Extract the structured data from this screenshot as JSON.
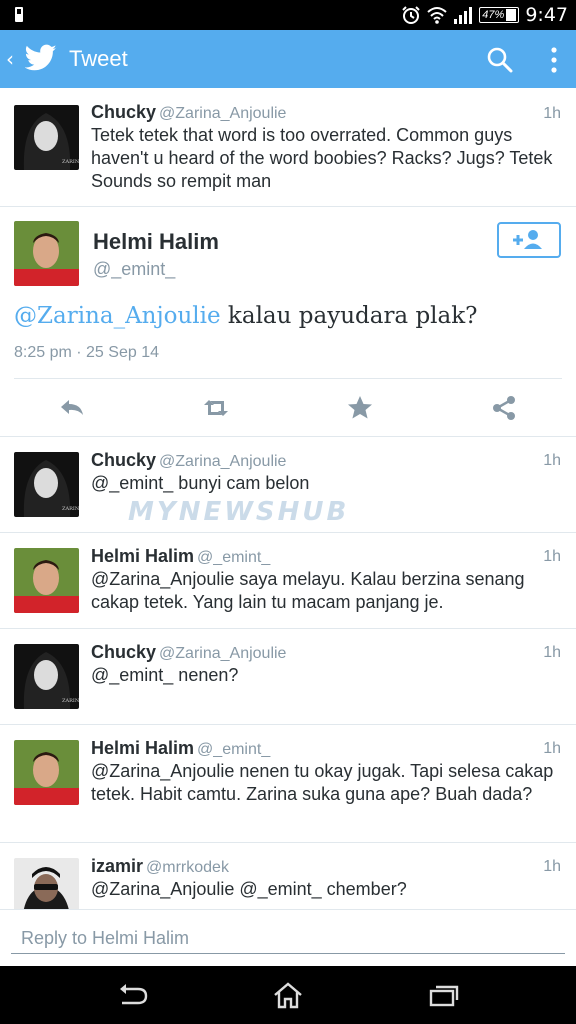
{
  "status_bar": {
    "time": "9:47",
    "battery": "47%"
  },
  "app_bar": {
    "back": "‹",
    "title": "Tweet"
  },
  "replies_above": [
    {
      "name": "Chucky",
      "handle": "@Zarina_Anjoulie",
      "time": "1h",
      "text": "Tetek tetek that word is too overrated. Common guys haven't u heard of the word boobies? Racks? Jugs? Tetek Sounds so rempit man"
    }
  ],
  "main_tweet": {
    "name": "Helmi Halim",
    "handle": "@_emint_",
    "mention": "@Zarina_Anjoulie",
    "text": " kalau payudara plak?",
    "meta": "8:25 pm · 25 Sep 14"
  },
  "replies_below": [
    {
      "name": "Chucky",
      "handle": "@Zarina_Anjoulie",
      "time": "1h",
      "text": "@_emint_ bunyi cam belon"
    },
    {
      "name": "Helmi Halim",
      "handle": "@_emint_",
      "time": "1h",
      "text": "@Zarina_Anjoulie saya melayu. Kalau berzina senang cakap tetek. Yang lain tu macam panjang je."
    },
    {
      "name": "Chucky",
      "handle": "@Zarina_Anjoulie",
      "time": "1h",
      "text": "@_emint_ nenen?"
    },
    {
      "name": "Helmi Halim",
      "handle": "@_emint_",
      "time": "1h",
      "text": "@Zarina_Anjoulie nenen tu okay jugak. Tapi selesa cakap tetek. Habit camtu. Zarina suka guna ape? Buah dada?"
    },
    {
      "name": "izamir",
      "handle": "@mrrkodek",
      "time": "1h",
      "text": "@Zarina_Anjoulie @_emint_ chember?"
    }
  ],
  "watermark": "MYNEWSHUB",
  "reply_box": {
    "placeholder": "Reply to Helmi Halim"
  },
  "icons": {
    "status": [
      "alarm-icon",
      "wifi-icon",
      "signal-icon",
      "battery-icon"
    ],
    "app_bar": [
      "back-icon",
      "twitter-bird-icon",
      "search-icon",
      "more-vert-icon"
    ],
    "actions": [
      "reply-icon",
      "retweet-icon",
      "favorite-icon",
      "share-icon"
    ],
    "nav": [
      "nav-back-icon",
      "nav-home-icon",
      "nav-recents-icon"
    ]
  },
  "colors": {
    "accent": "#55acee",
    "text": "#292f33",
    "muted": "#8899a6",
    "divider": "#e1e8ed"
  }
}
